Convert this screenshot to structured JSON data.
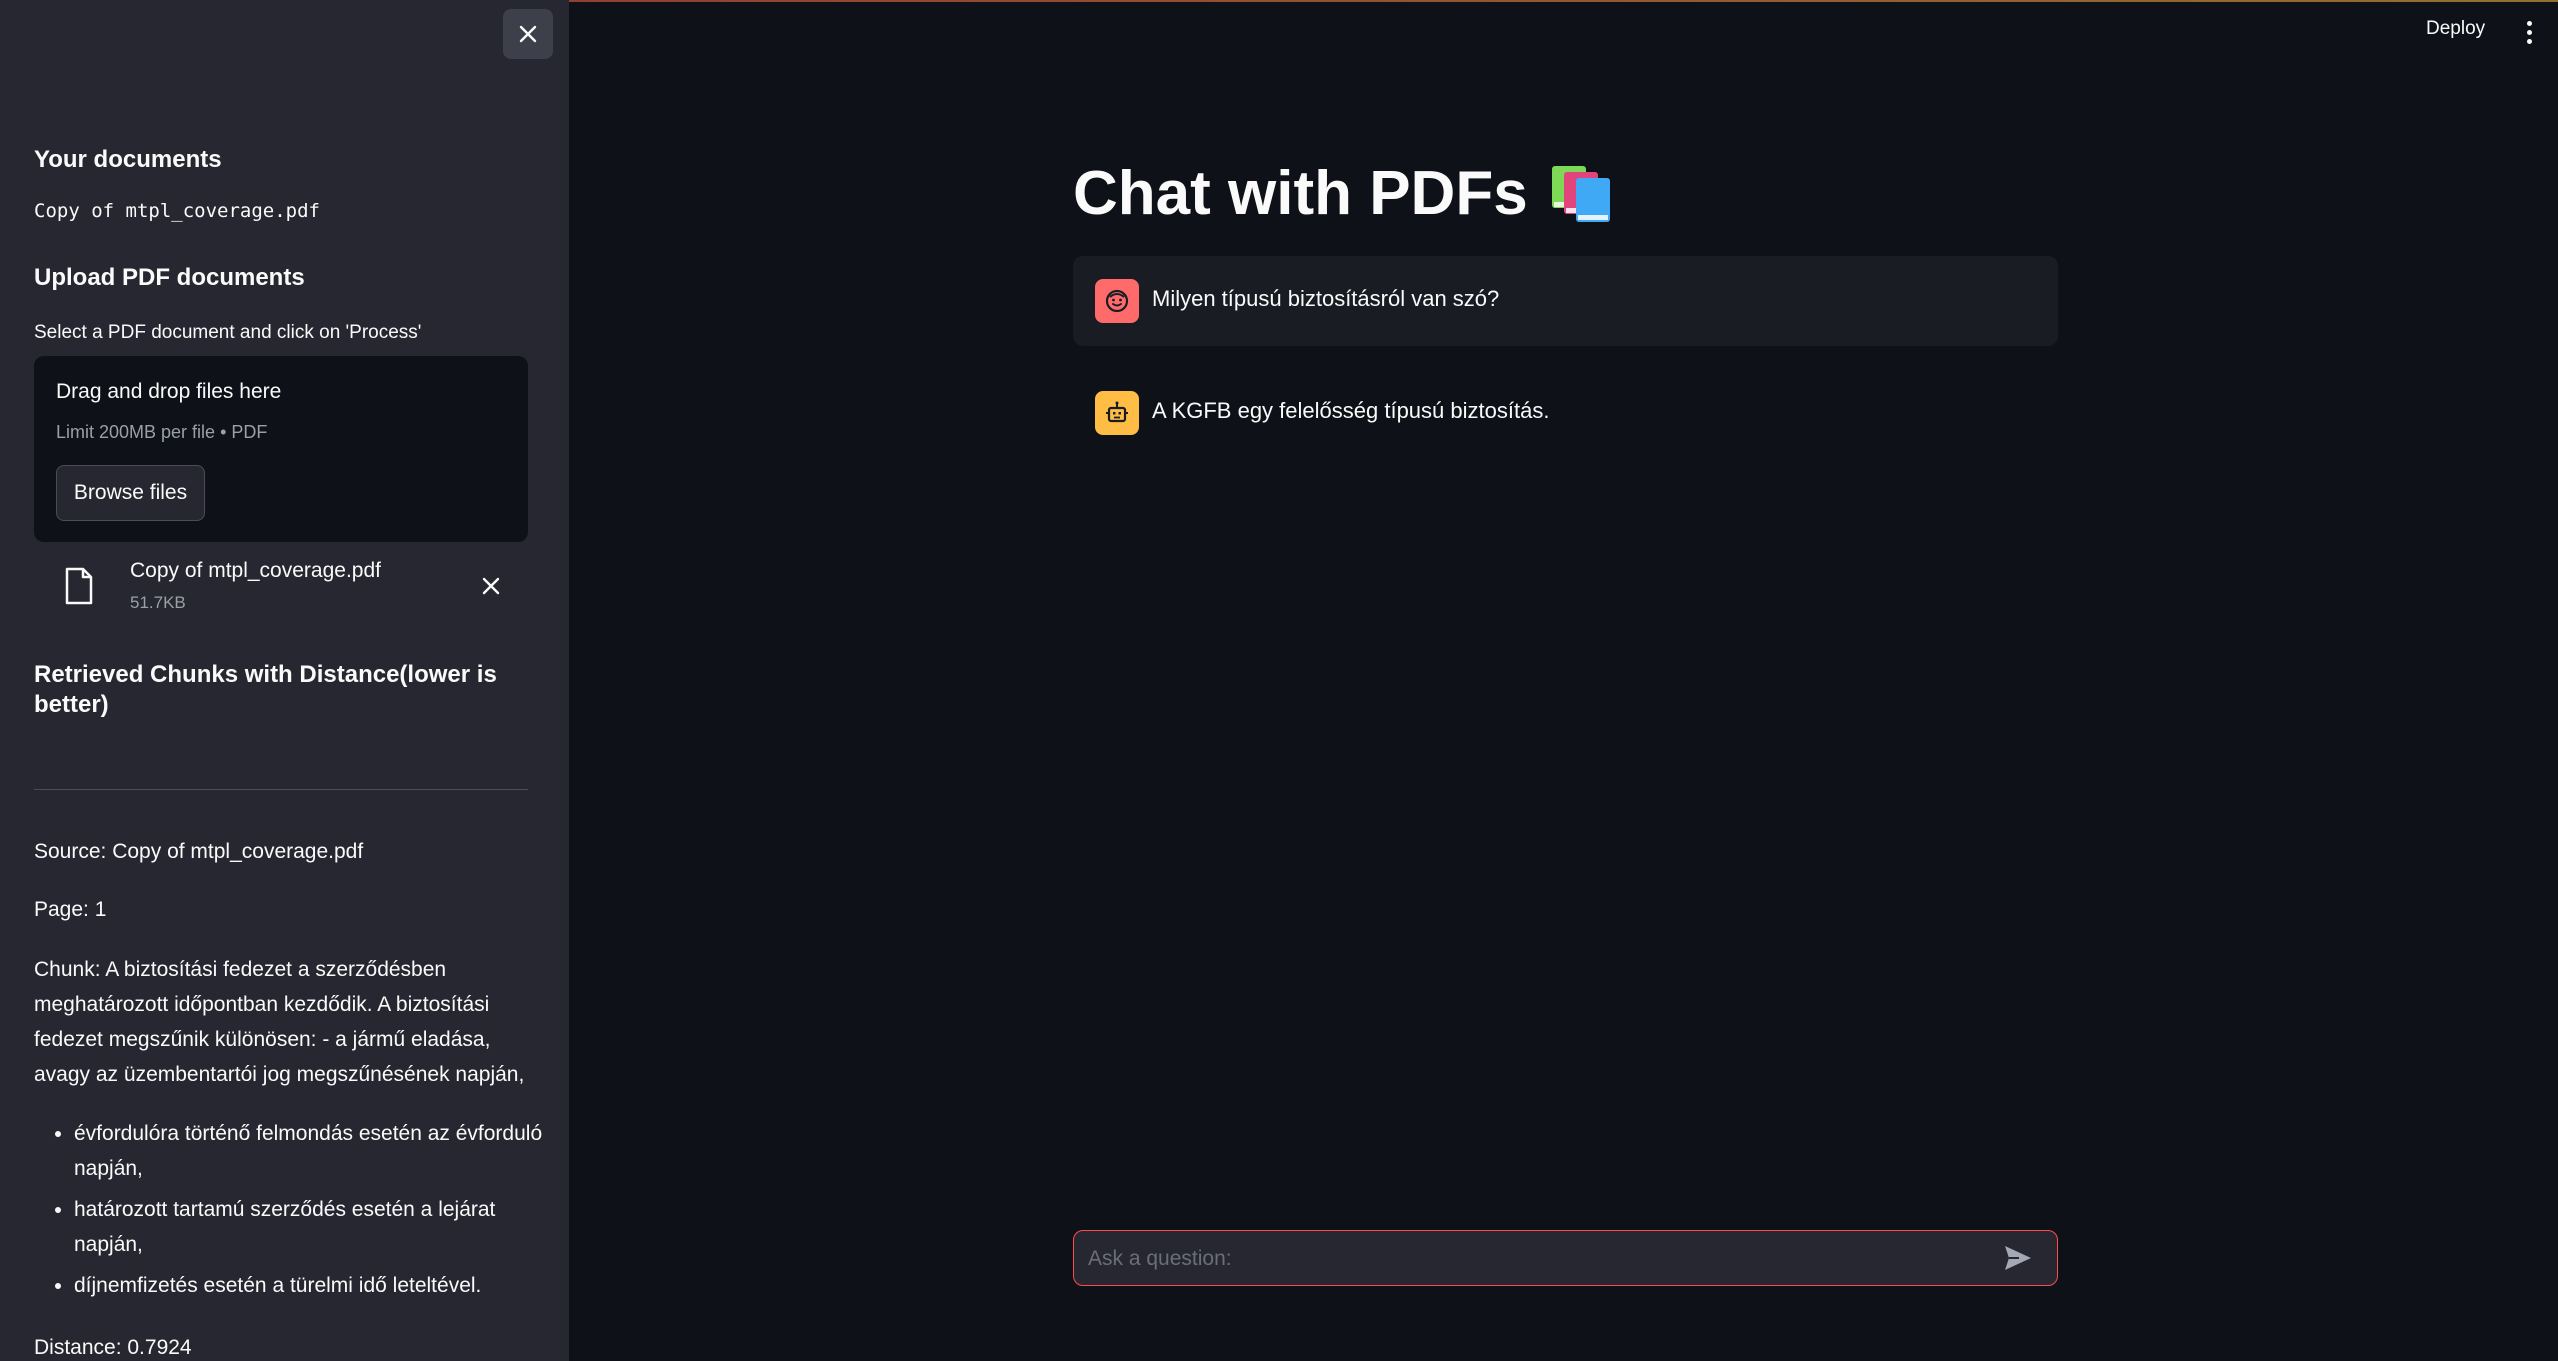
{
  "sidebar": {
    "documents_heading": "Your documents",
    "document_name": "Copy of mtpl_coverage.pdf",
    "upload_heading": "Upload PDF documents",
    "upload_help": "Select a PDF document and click on 'Process'",
    "dropzone_title": "Drag and drop files here",
    "dropzone_limit": "Limit 200MB per file • PDF",
    "browse_label": "Browse files",
    "uploaded_file": {
      "name": "Copy of mtpl_coverage.pdf",
      "size": "51.7KB"
    },
    "chunks_heading": "Retrieved Chunks with Distance(lower is better)",
    "source": "Source: Copy of mtpl_coverage.pdf",
    "page": "Page: 1",
    "chunk_text": "Chunk: A biztosítási fedezet a szerződésben meghatározott időpontban kezdődik. A biztosítási fedezet megszűnik különösen: - a jármű eladása, avagy az üzembentartói jog megszűnésének napján,",
    "chunk_bullets": [
      "évfordulóra történő felmondás esetén az évforduló napján,",
      "határozott tartamú szerződés esetén a lejárat napján,",
      "díjnemfizetés esetén a türelmi idő leteltével."
    ],
    "distance": "Distance: 0.7924"
  },
  "header": {
    "deploy_label": "Deploy"
  },
  "main": {
    "title": "Chat with PDFs",
    "messages": [
      {
        "role": "user",
        "text": "Milyen típusú biztosításról van szó?"
      },
      {
        "role": "assistant",
        "text": "A KGFB egy felelősség típusú biztosítás."
      }
    ],
    "input_placeholder": "Ask a question:"
  },
  "colors": {
    "accent": "#ff4b4b",
    "user_avatar": "#ff6b6b",
    "bot_avatar": "#ffbd45",
    "background": "#0e1117",
    "sidebar": "#262730"
  }
}
